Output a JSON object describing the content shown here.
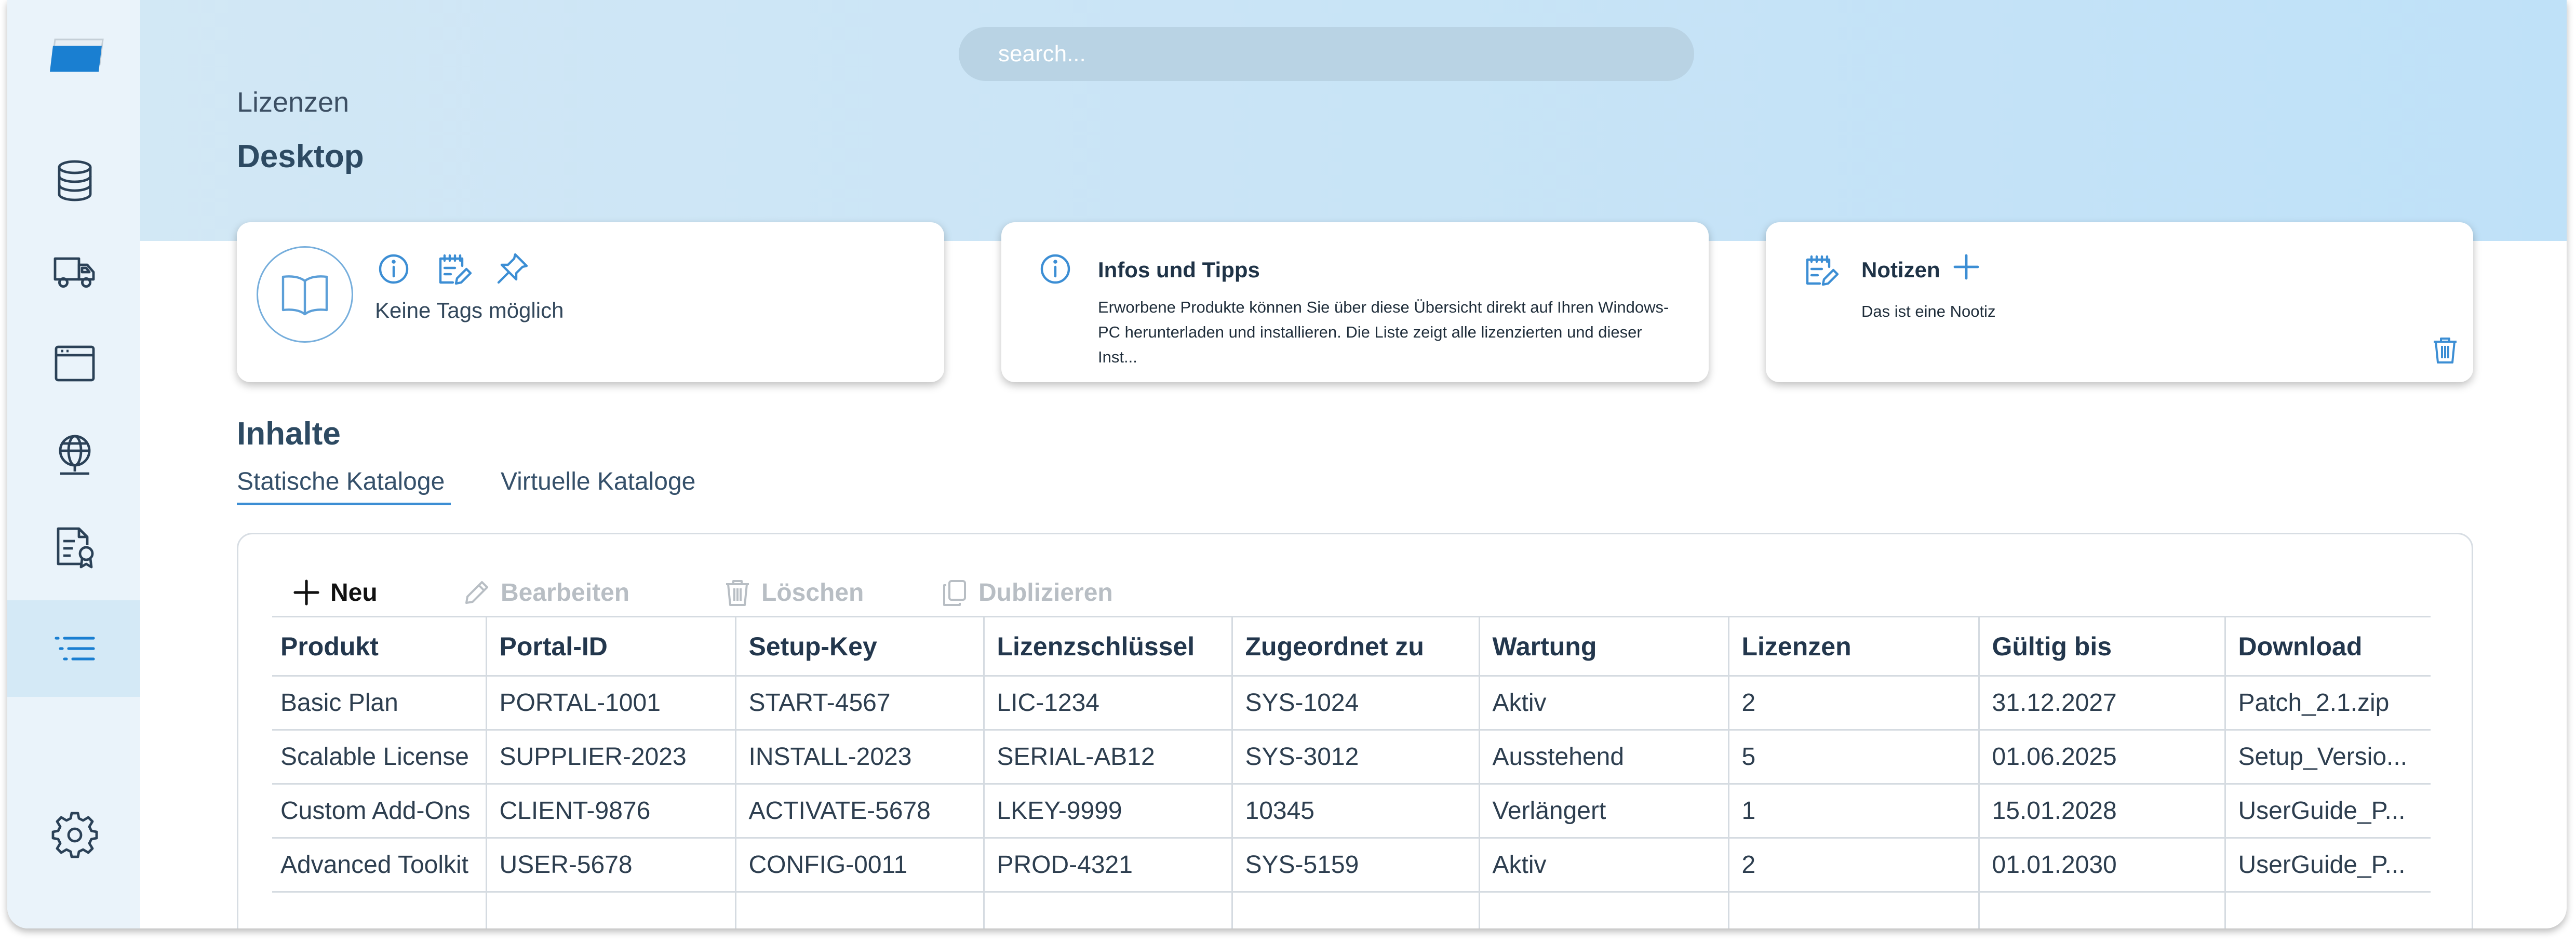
{
  "header": {
    "search_placeholder": "search...",
    "breadcrumb": "Lizenzen",
    "page_title": "Desktop"
  },
  "sidebar": {
    "items": [
      {
        "icon": "database-icon"
      },
      {
        "icon": "truck-icon"
      },
      {
        "icon": "browser-window-icon"
      },
      {
        "icon": "globe-icon"
      },
      {
        "icon": "certificate-icon"
      },
      {
        "icon": "list-icon",
        "active": true
      },
      {
        "icon": "gear-icon"
      }
    ]
  },
  "tag_card": {
    "icons": [
      "book-open-icon",
      "info-icon",
      "note-edit-icon",
      "pin-icon"
    ],
    "no_tags_text": "Keine Tags möglich"
  },
  "info_card": {
    "title": "Infos und Tipps",
    "text": "Erworbene Produkte können Sie über diese Übersicht direkt auf Ihren Windows-PC herunterladen und installieren. Die Liste zeigt alle lizenzierten und dieser Inst..."
  },
  "notes_card": {
    "title": "Notizen",
    "text": "Das ist eine Nootiz"
  },
  "section": {
    "title": "Inhalte",
    "tabs": [
      {
        "label": "Statische Kataloge",
        "active": true
      },
      {
        "label": "Virtuelle Kataloge",
        "active": false
      }
    ]
  },
  "toolbar": {
    "new_label": "Neu",
    "edit_label": "Bearbeiten",
    "delete_label": "Löschen",
    "duplicate_label": "Dublizieren"
  },
  "table": {
    "columns": [
      "Produkt",
      "Portal-ID",
      "Setup-Key",
      "Lizenzschlüssel",
      "Zugeordnet zu",
      "Wartung",
      "Lizenzen",
      "Gültig bis",
      "Download"
    ],
    "rows": [
      [
        "Basic Plan",
        "PORTAL-1001",
        "START-4567",
        "LIC-1234",
        "SYS-1024",
        "Aktiv",
        "2",
        "31.12.2027",
        "Patch_2.1.zip"
      ],
      [
        "Scalable License",
        "SUPPLIER-2023",
        "INSTALL-2023",
        "SERIAL-AB12",
        "SYS-3012",
        "Ausstehend",
        "5",
        "01.06.2025",
        "Setup_Versio..."
      ],
      [
        "Custom Add-Ons",
        "CLIENT-9876",
        "ACTIVATE-5678",
        "LKEY-9999",
        "10345",
        "Verlängert",
        "1",
        "15.01.2028",
        "UserGuide_P..."
      ],
      [
        "Advanced Toolkit",
        "USER-5678",
        "CONFIG-0011",
        "PROD-4321",
        "SYS-5159",
        "Aktiv",
        "2",
        "01.01.2030",
        "UserGuide_P..."
      ]
    ]
  },
  "colors": {
    "accent": "#3c8ed4",
    "hero_background": "#c9e4f6",
    "sidebar_background": "#eaf3fa",
    "text_dark": "#23374d",
    "disabled": "#b8bec4"
  }
}
